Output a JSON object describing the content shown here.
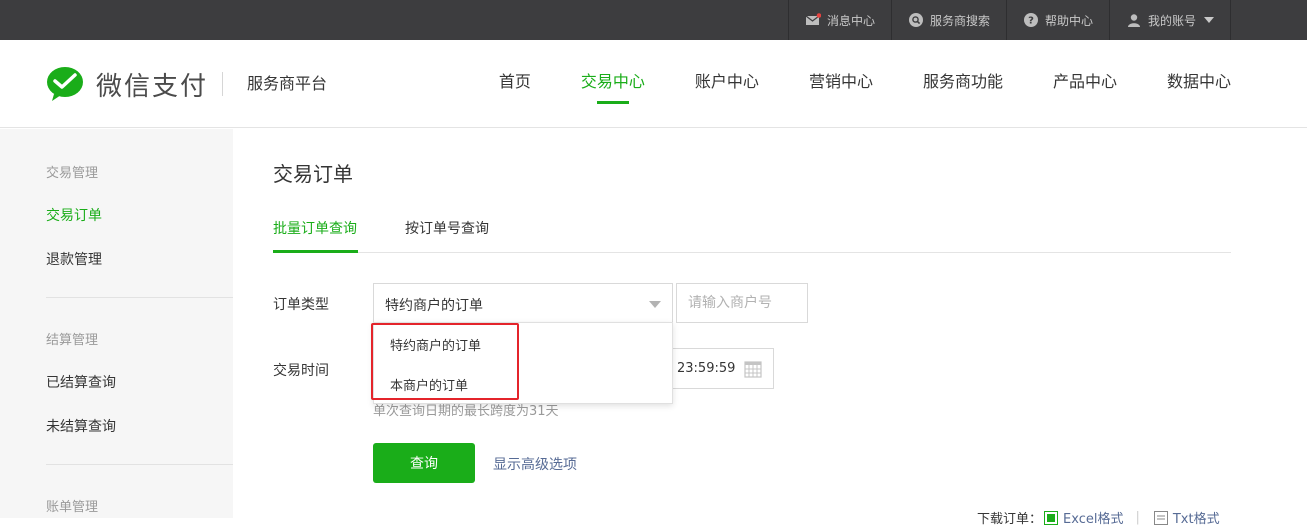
{
  "topbar": {
    "items": [
      {
        "label": "消息中心",
        "icon": "mail-icon"
      },
      {
        "label": "服务商搜索",
        "icon": "search-icon"
      },
      {
        "label": "帮助中心",
        "icon": "help-icon"
      },
      {
        "label": "我的账号",
        "icon": "user-icon"
      }
    ]
  },
  "header": {
    "brand": "微信支付",
    "platform": "服务商平台",
    "nav": [
      "首页",
      "交易中心",
      "账户中心",
      "营销中心",
      "服务商功能",
      "产品中心",
      "数据中心"
    ],
    "active_nav": "交易中心"
  },
  "sidebar": {
    "groups": [
      {
        "title": "交易管理",
        "items": [
          "交易订单",
          "退款管理"
        ]
      },
      {
        "title": "结算管理",
        "items": [
          "已结算查询",
          "未结算查询"
        ]
      },
      {
        "title": "账单管理",
        "items": []
      }
    ],
    "active_item": "交易订单"
  },
  "main": {
    "title": "交易订单",
    "tabs": [
      "批量订单查询",
      "按订单号查询"
    ],
    "active_tab": "批量订单查询",
    "order_type_label": "订单类型",
    "order_type_value": "特约商户的订单",
    "order_type_options": [
      "特约商户的订单",
      "本商户的订单"
    ],
    "merchant_placeholder": "请输入商户号",
    "time_label": "交易时间",
    "end_time": "23:59:59",
    "range_hint": "单次查询日期的最长跨度为31天",
    "query_button": "查询",
    "advanced_link": "显示高级选项",
    "download_label": "下载订单：",
    "excel_link": "Excel格式",
    "txt_link": "Txt格式"
  },
  "colors": {
    "accent": "#1aad19",
    "topbar_bg": "#3d3d3f",
    "link": "#576b95",
    "highlight_border": "#e4242b"
  }
}
